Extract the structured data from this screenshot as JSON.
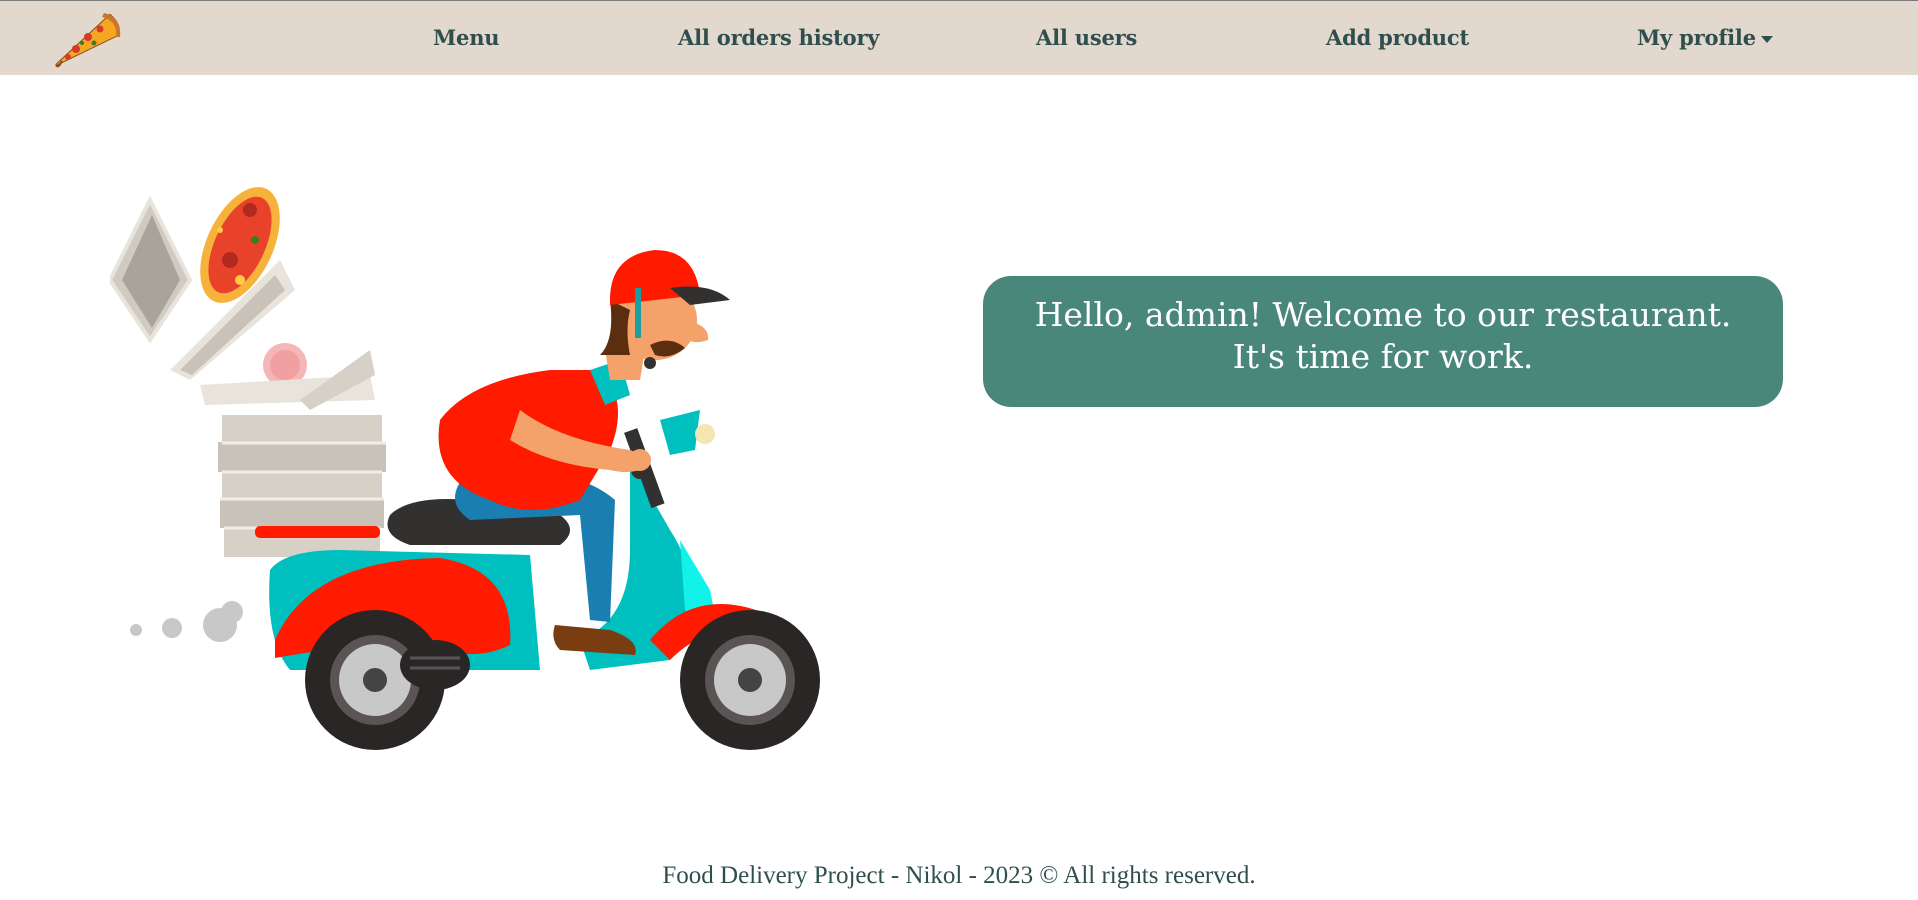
{
  "nav": {
    "logo_icon": "pizza-slice-icon",
    "items": [
      {
        "label": "Menu"
      },
      {
        "label": "All orders history"
      },
      {
        "label": "All users"
      },
      {
        "label": "Add product"
      },
      {
        "label": "My profile"
      }
    ],
    "profile_caret_icon": "caret-down-icon"
  },
  "main": {
    "illustration": "pizza-delivery-scooter-illustration",
    "welcome_message": "Hello, admin! Welcome to our restaurant. It's time for work."
  },
  "footer": {
    "text": "Food Delivery Project - Nikol - 2023 © All rights reserved."
  },
  "colors": {
    "navbar_bg": "#e2d8cd",
    "nav_text": "#2f4f4f",
    "welcome_bg": "#4a877b",
    "welcome_text": "#ffffff"
  }
}
